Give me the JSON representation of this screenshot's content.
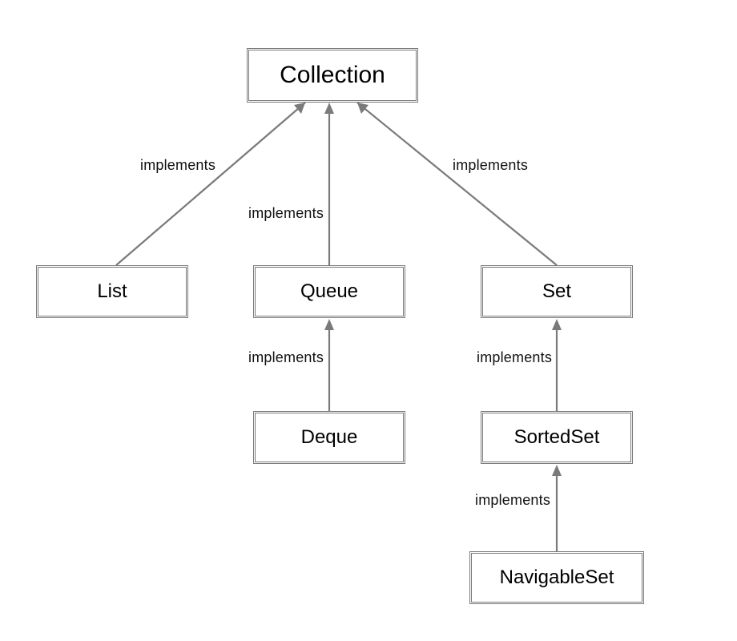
{
  "diagram": {
    "nodes": {
      "collection": "Collection",
      "list": "List",
      "queue": "Queue",
      "set": "Set",
      "deque": "Deque",
      "sortedset": "SortedSet",
      "navigableset": "NavigableSet"
    },
    "edge_label": "implements",
    "edges": [
      {
        "from": "list",
        "to": "collection"
      },
      {
        "from": "queue",
        "to": "collection"
      },
      {
        "from": "set",
        "to": "collection"
      },
      {
        "from": "deque",
        "to": "queue"
      },
      {
        "from": "sortedset",
        "to": "set"
      },
      {
        "from": "navigableset",
        "to": "sortedset"
      }
    ]
  }
}
